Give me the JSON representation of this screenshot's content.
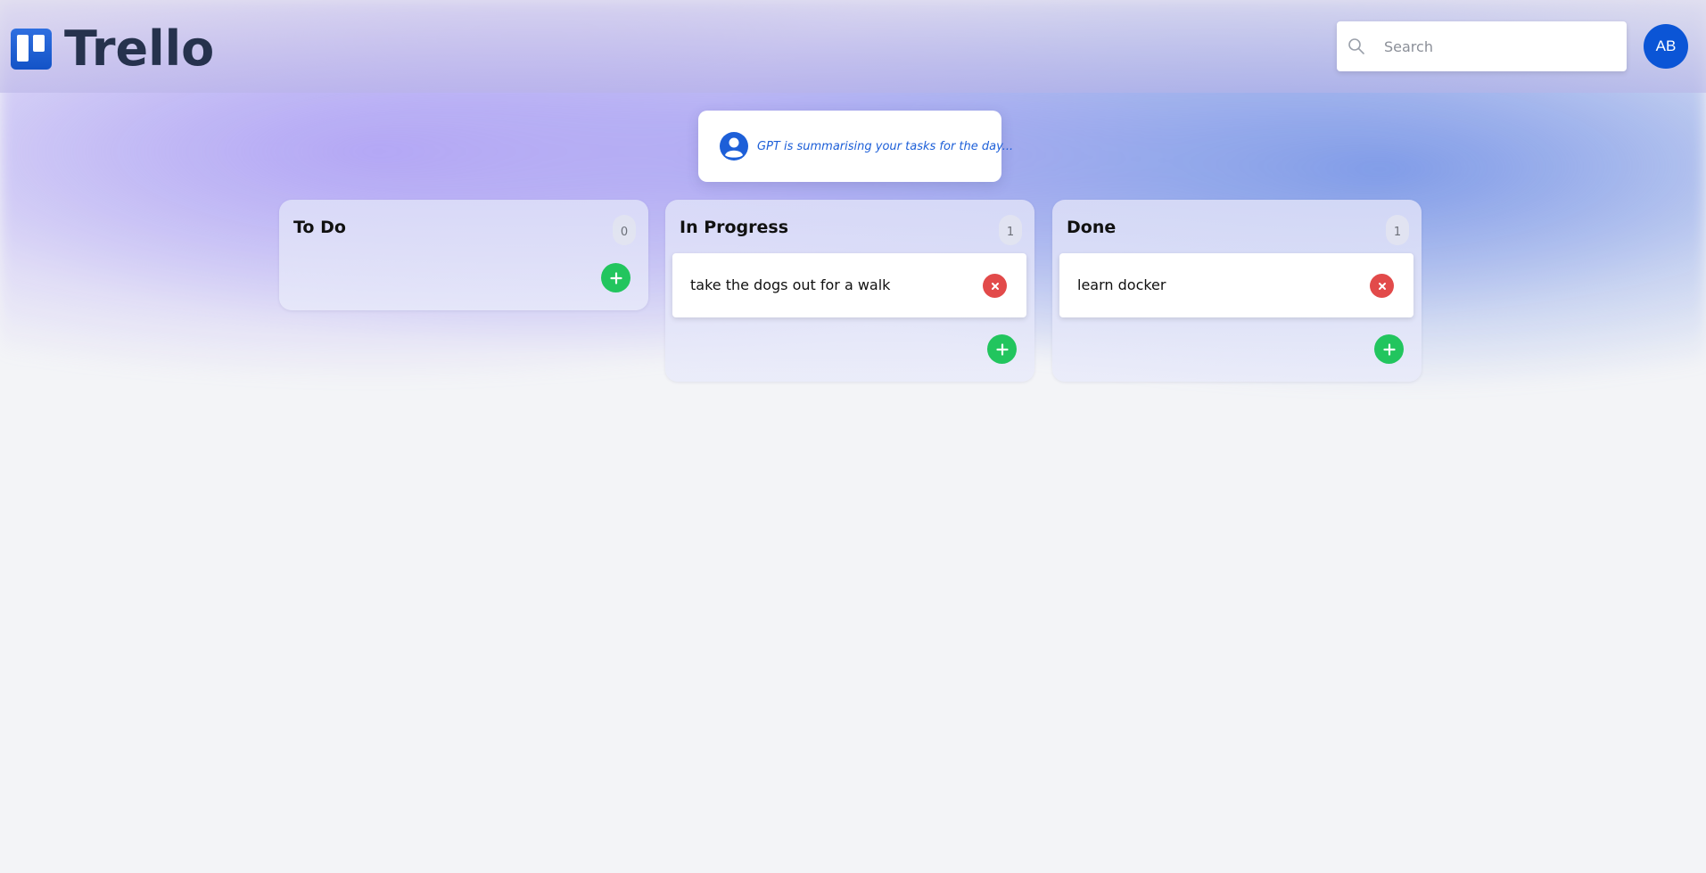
{
  "app": {
    "logo_text": "Trello",
    "brand_color": "#0b55d6"
  },
  "header": {
    "search": {
      "placeholder": "Search",
      "icon": "search-icon"
    },
    "avatar": {
      "initials": "AB",
      "color": "#0b55d6"
    }
  },
  "gpt_summary": {
    "icon": "user-circle-icon",
    "text": "GPT is summarising your tasks for the day..."
  },
  "columns": [
    {
      "title": "To Do",
      "count": "0",
      "cards": []
    },
    {
      "title": "In Progress",
      "count": "1",
      "cards": [
        {
          "text": "take the dogs out for a walk"
        }
      ]
    },
    {
      "title": "Done",
      "count": "1",
      "cards": [
        {
          "text": "learn docker"
        }
      ]
    }
  ],
  "colors": {
    "add_button": "#22c55e",
    "remove_button": "#e24a4a"
  }
}
